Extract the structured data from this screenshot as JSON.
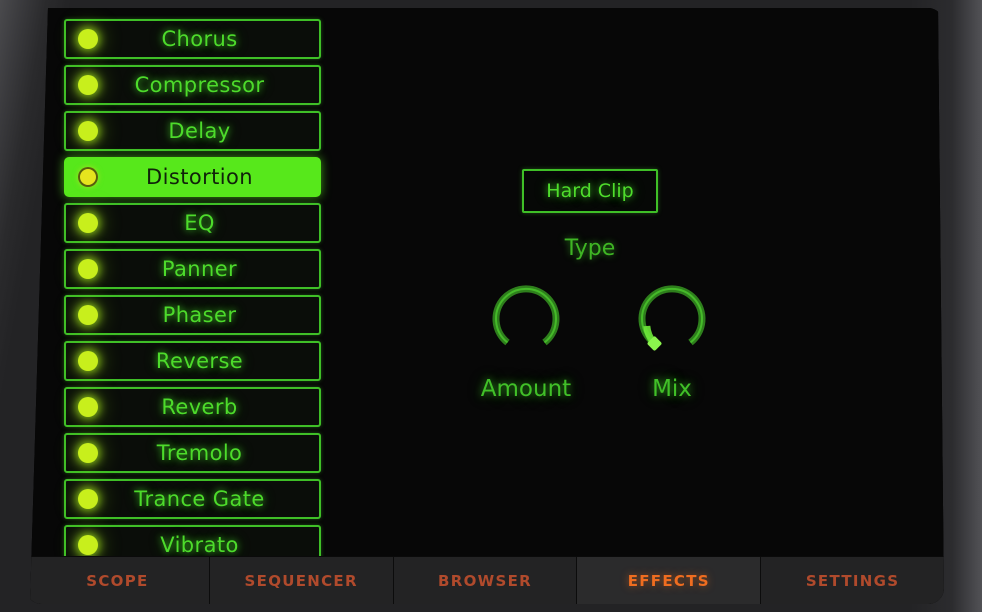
{
  "app": {
    "title": "Effects",
    "accent_green": "#4ddb2b",
    "accent_green_bright": "#57e81b",
    "accent_led": "#c8ef1c",
    "accent_orange": "#ef6d20",
    "accent_orange_dim": "#b04a2c",
    "screen_bg": "#070707"
  },
  "effects_list": {
    "selected_index": 3,
    "items": [
      {
        "label": "Chorus",
        "led": "on",
        "selected": false
      },
      {
        "label": "Compressor",
        "led": "on",
        "selected": false
      },
      {
        "label": "Delay",
        "led": "on",
        "selected": false
      },
      {
        "label": "Distortion",
        "led": "active",
        "selected": true
      },
      {
        "label": "EQ",
        "led": "on",
        "selected": false
      },
      {
        "label": "Panner",
        "led": "on",
        "selected": false
      },
      {
        "label": "Phaser",
        "led": "on",
        "selected": false
      },
      {
        "label": "Reverse",
        "led": "on",
        "selected": false
      },
      {
        "label": "Reverb",
        "led": "on",
        "selected": false
      },
      {
        "label": "Tremolo",
        "led": "on",
        "selected": false
      },
      {
        "label": "Trance Gate",
        "led": "on",
        "selected": false
      },
      {
        "label": "Vibrato",
        "led": "on",
        "selected": false
      }
    ]
  },
  "parameters": {
    "type": {
      "label": "Type",
      "value": "Hard Clip"
    },
    "knobs": [
      {
        "name": "Amount",
        "value_pct": 0,
        "indicator": "none"
      },
      {
        "name": "Mix",
        "value_pct": 0,
        "indicator": "bright"
      }
    ]
  },
  "tabs": [
    {
      "label": "SCOPE",
      "active": false
    },
    {
      "label": "SEQUENCER",
      "active": false
    },
    {
      "label": "BROWSER",
      "active": false
    },
    {
      "label": "EFFECTS",
      "active": true
    },
    {
      "label": "SETTINGS",
      "active": false
    }
  ]
}
